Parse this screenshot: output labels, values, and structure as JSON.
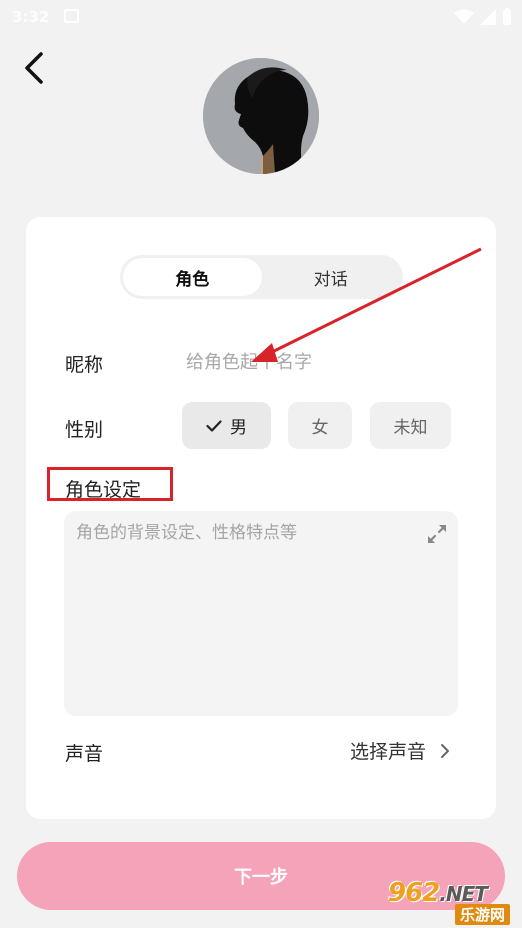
{
  "status_bar": {
    "time": "3:32"
  },
  "header": {
    "back_icon": "chevron-left-icon"
  },
  "avatar": {
    "icon": "silhouette-avatar"
  },
  "tabs": [
    {
      "label": "角色",
      "active": true
    },
    {
      "label": "对话",
      "active": false
    }
  ],
  "nickname": {
    "label": "昵称",
    "placeholder": "给角色起个名字",
    "value": ""
  },
  "gender": {
    "label": "性别",
    "options": [
      {
        "label": "男",
        "selected": true
      },
      {
        "label": "女",
        "selected": false
      },
      {
        "label": "未知",
        "selected": false
      }
    ],
    "check_icon": "check-icon"
  },
  "role_setting": {
    "label": "角色设定",
    "placeholder": "角色的背景设定、性格特点等",
    "value": "",
    "expand_icon": "expand-icon"
  },
  "voice": {
    "label": "声音",
    "value": "选择声音",
    "chevron_icon": "chevron-right-icon"
  },
  "next_button": {
    "label": "下一步"
  },
  "watermark": {
    "main": "962",
    "suffix": ".NET",
    "sub": "乐游网"
  },
  "colors": {
    "accent": "#f5a3b9",
    "annotation": "#d9232a"
  }
}
